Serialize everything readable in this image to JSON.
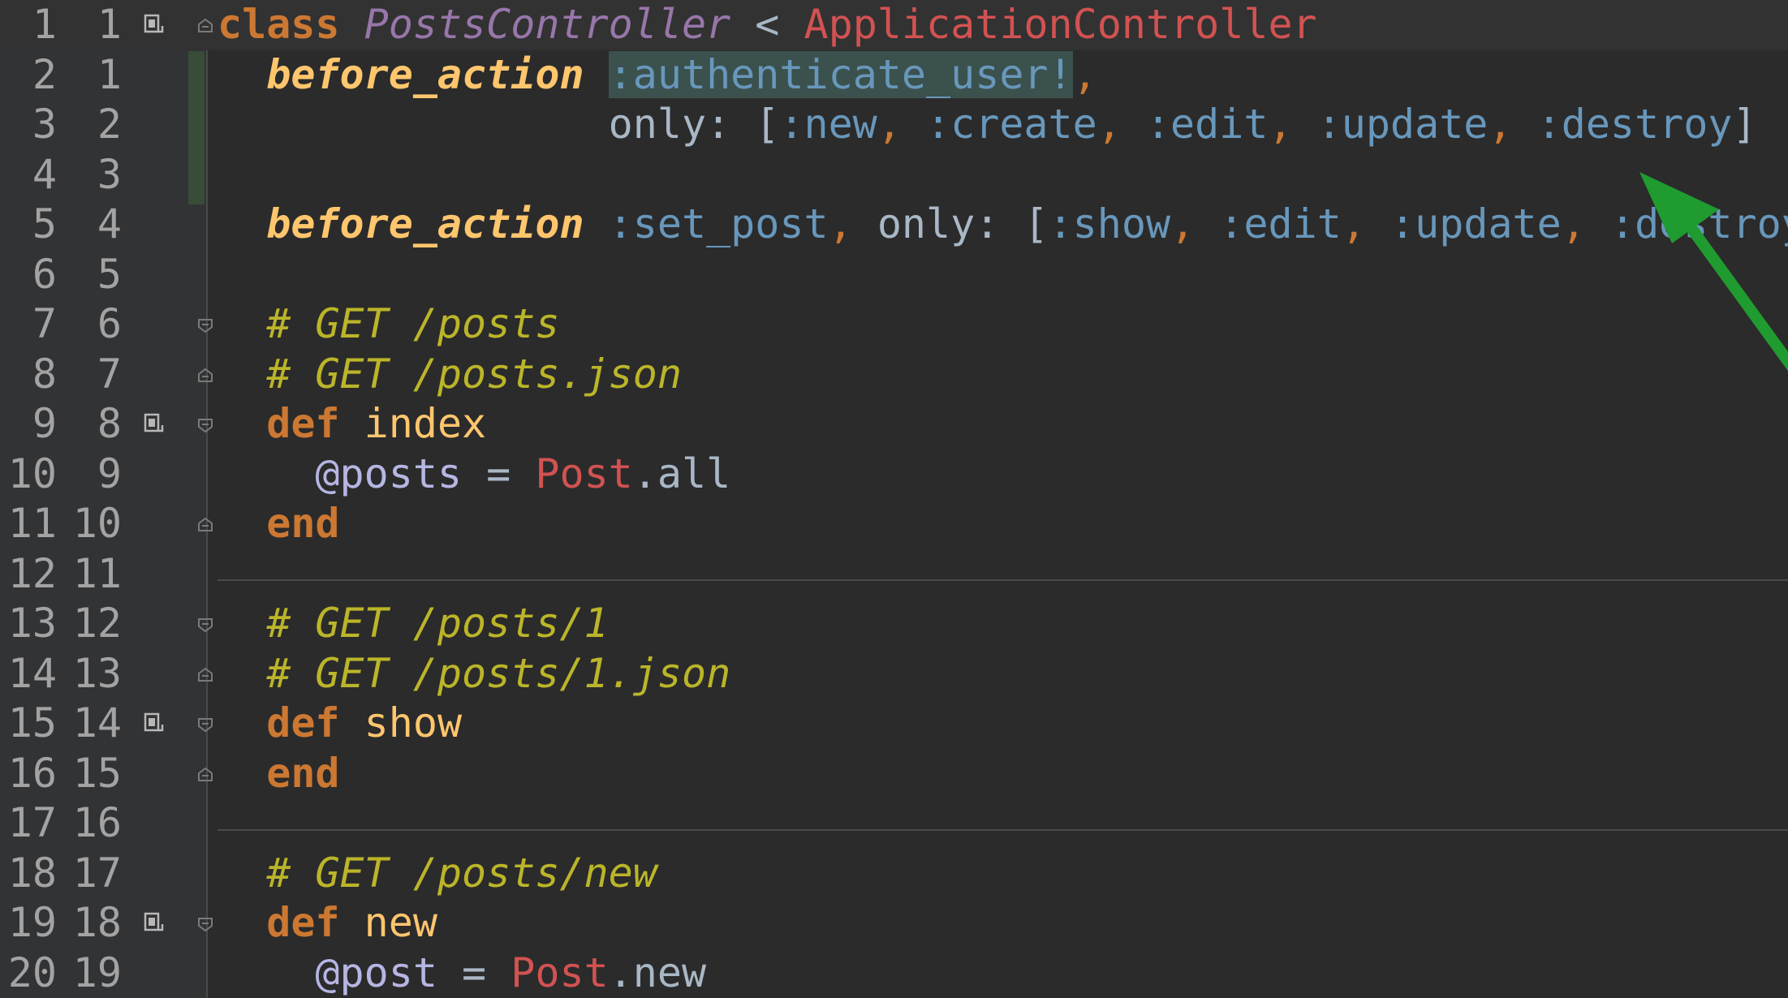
{
  "editor": {
    "lines": [
      {
        "old": "1",
        "new": "1",
        "bookmark": true,
        "fold": "⌃",
        "current": true,
        "tokens": [
          [
            "kw",
            "class"
          ],
          [
            "plain",
            " "
          ],
          [
            "itcls",
            "PostsController"
          ],
          [
            "plain",
            " "
          ],
          [
            "plain",
            "<"
          ],
          [
            "plain",
            " "
          ],
          [
            "const",
            "ApplicationController"
          ]
        ]
      },
      {
        "old": "2",
        "new": "1",
        "tokens": [
          [
            "plain",
            "  "
          ],
          [
            "it",
            "before_action"
          ],
          [
            "plain",
            " "
          ],
          [
            "symhl",
            ":authenticate_user!"
          ],
          [
            "punct",
            ","
          ]
        ]
      },
      {
        "old": "3",
        "new": "2",
        "tokens": [
          [
            "plain",
            "                "
          ],
          [
            "plain",
            "only:"
          ],
          [
            "plain",
            " "
          ],
          [
            "plain",
            "["
          ],
          [
            "sym",
            ":new"
          ],
          [
            "punct",
            ","
          ],
          [
            "plain",
            " "
          ],
          [
            "sym",
            ":create"
          ],
          [
            "punct",
            ","
          ],
          [
            "plain",
            " "
          ],
          [
            "sym",
            ":edit"
          ],
          [
            "punct",
            ","
          ],
          [
            "plain",
            " "
          ],
          [
            "sym",
            ":update"
          ],
          [
            "punct",
            ","
          ],
          [
            "plain",
            " "
          ],
          [
            "sym",
            ":destroy"
          ],
          [
            "plain",
            "]"
          ]
        ]
      },
      {
        "old": "4",
        "new": "3",
        "tokens": []
      },
      {
        "old": "5",
        "new": "4",
        "tokens": [
          [
            "plain",
            "  "
          ],
          [
            "it",
            "before_action"
          ],
          [
            "plain",
            " "
          ],
          [
            "sym",
            ":set_post"
          ],
          [
            "punct",
            ","
          ],
          [
            "plain",
            " "
          ],
          [
            "plain",
            "only:"
          ],
          [
            "plain",
            " "
          ],
          [
            "plain",
            "["
          ],
          [
            "sym",
            ":show"
          ],
          [
            "punct",
            ","
          ],
          [
            "plain",
            " "
          ],
          [
            "sym",
            ":edit"
          ],
          [
            "punct",
            ","
          ],
          [
            "plain",
            " "
          ],
          [
            "sym",
            ":update"
          ],
          [
            "punct",
            ","
          ],
          [
            "plain",
            " "
          ],
          [
            "sym",
            ":destroy"
          ],
          [
            "plain",
            "]"
          ]
        ]
      },
      {
        "old": "6",
        "new": "5",
        "tokens": []
      },
      {
        "old": "7",
        "new": "6",
        "fold": "⌄",
        "tokens": [
          [
            "plain",
            "  "
          ],
          [
            "comment",
            "# GET /posts"
          ]
        ]
      },
      {
        "old": "8",
        "new": "7",
        "fold": "⌃",
        "tokens": [
          [
            "plain",
            "  "
          ],
          [
            "comment",
            "# GET /posts.json"
          ]
        ]
      },
      {
        "old": "9",
        "new": "8",
        "bookmark": true,
        "fold": "⌄",
        "tokens": [
          [
            "plain",
            "  "
          ],
          [
            "kw",
            "def"
          ],
          [
            "plain",
            " "
          ],
          [
            "fn",
            "index"
          ]
        ]
      },
      {
        "old": "10",
        "new": "9",
        "tokens": [
          [
            "plain",
            "    "
          ],
          [
            "ivar",
            "@posts"
          ],
          [
            "plain",
            " "
          ],
          [
            "plain",
            "="
          ],
          [
            "plain",
            " "
          ],
          [
            "const",
            "Post"
          ],
          [
            "plain",
            ".all"
          ]
        ]
      },
      {
        "old": "11",
        "new": "10",
        "fold": "⌃",
        "tokens": [
          [
            "plain",
            "  "
          ],
          [
            "kw",
            "end"
          ]
        ]
      },
      {
        "old": "12",
        "new": "11",
        "tokens": [],
        "sep": true
      },
      {
        "old": "13",
        "new": "12",
        "fold": "⌄",
        "tokens": [
          [
            "plain",
            "  "
          ],
          [
            "comment",
            "# GET /posts/1"
          ]
        ]
      },
      {
        "old": "14",
        "new": "13",
        "fold": "⌃",
        "tokens": [
          [
            "plain",
            "  "
          ],
          [
            "comment",
            "# GET /posts/1.json"
          ]
        ]
      },
      {
        "old": "15",
        "new": "14",
        "bookmark": true,
        "fold": "⌄",
        "tokens": [
          [
            "plain",
            "  "
          ],
          [
            "kw",
            "def"
          ],
          [
            "plain",
            " "
          ],
          [
            "fn",
            "show"
          ]
        ]
      },
      {
        "old": "16",
        "new": "15",
        "fold": "⌃",
        "tokens": [
          [
            "plain",
            "  "
          ],
          [
            "kw",
            "end"
          ]
        ]
      },
      {
        "old": "17",
        "new": "16",
        "tokens": [],
        "sep": true
      },
      {
        "old": "18",
        "new": "17",
        "tokens": [
          [
            "plain",
            "  "
          ],
          [
            "comment",
            "# GET /posts/new"
          ]
        ]
      },
      {
        "old": "19",
        "new": "18",
        "bookmark": true,
        "fold": "⌄",
        "tokens": [
          [
            "plain",
            "  "
          ],
          [
            "kw",
            "def"
          ],
          [
            "plain",
            " "
          ],
          [
            "fn",
            "new"
          ]
        ]
      },
      {
        "old": "20",
        "new": "19",
        "tokens": [
          [
            "plain",
            "    "
          ],
          [
            "ivar",
            "@post"
          ],
          [
            "plain",
            " "
          ],
          [
            "plain",
            "="
          ],
          [
            "plain",
            " "
          ],
          [
            "const",
            "Post"
          ],
          [
            "plain",
            ".new"
          ]
        ]
      }
    ]
  },
  "icons": {
    "bookmark": "bookmark-icon",
    "fold": "fold-marker-icon",
    "arrow": "green-arrow-annotation"
  },
  "colors": {
    "background": "#2b2b2b",
    "gutter": "#313335",
    "keyword": "#cc7832",
    "symbol": "#6897bb",
    "comment": "#bbb529",
    "constant": "#d25252",
    "annotation_arrow": "#1f9b2f"
  }
}
